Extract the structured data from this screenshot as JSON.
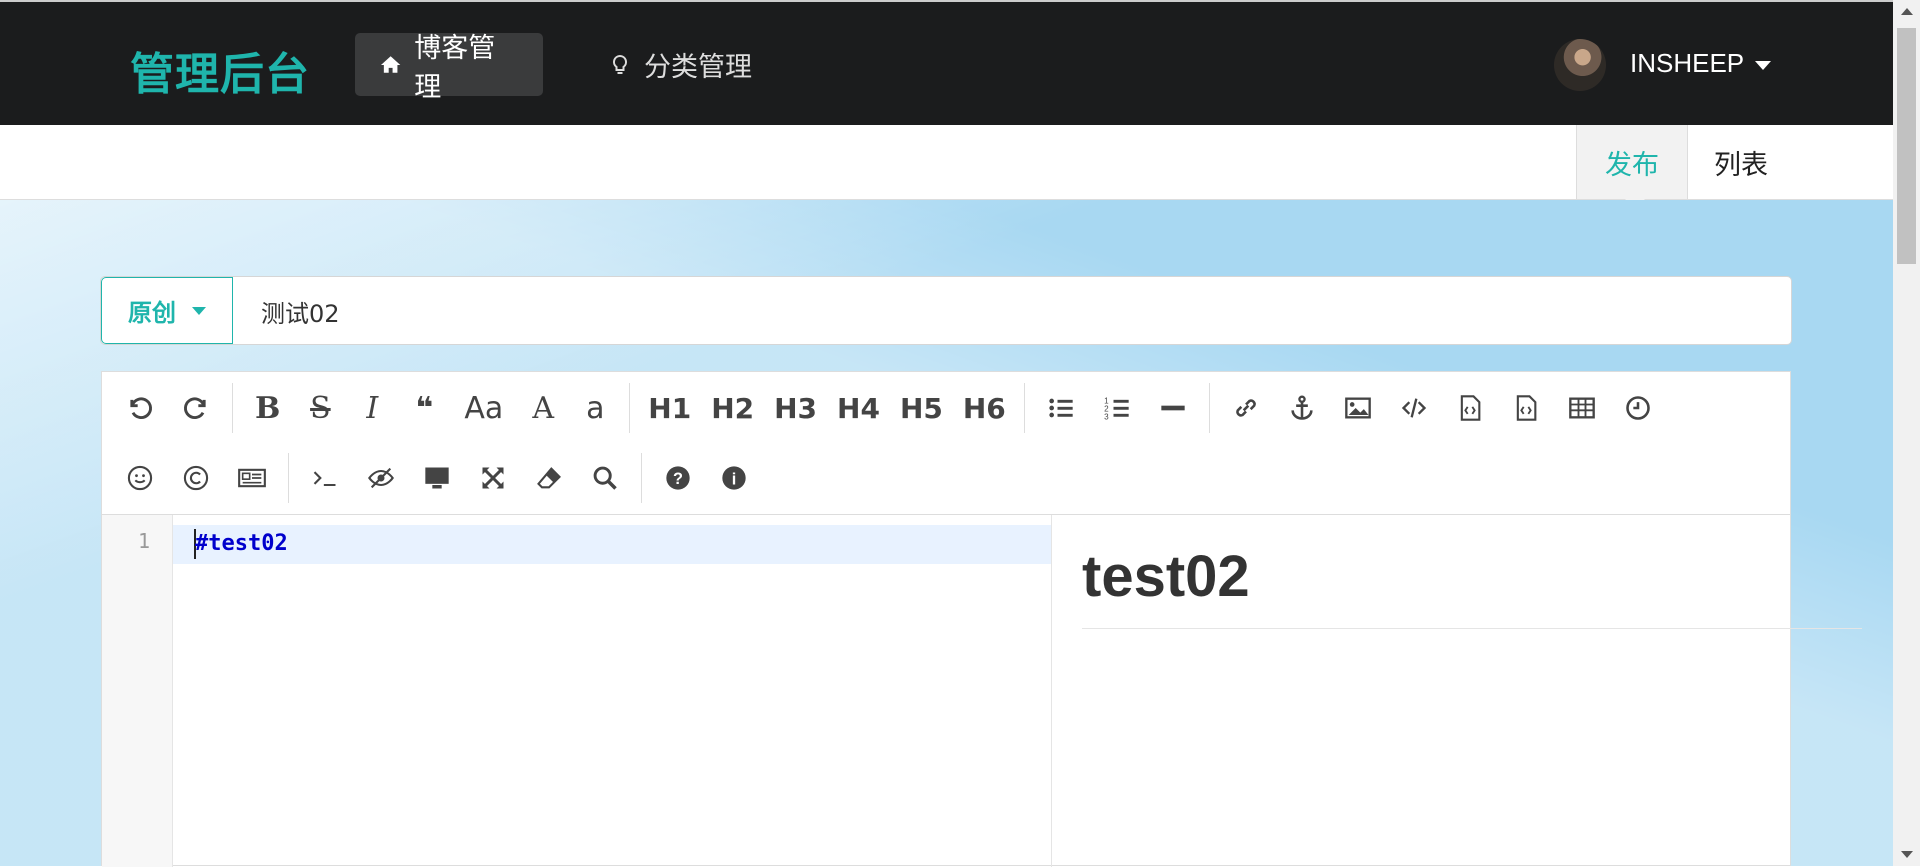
{
  "header": {
    "brand": "管理后台",
    "nav": [
      {
        "label": "博客管理",
        "icon": "home-icon",
        "active": true
      },
      {
        "label": "分类管理",
        "icon": "lightbulb-icon",
        "active": false
      }
    ],
    "username": "INSHEEP"
  },
  "tabs": [
    {
      "label": "发布",
      "active": true
    },
    {
      "label": "列表",
      "active": false
    }
  ],
  "form": {
    "type_label": "原创",
    "title_value": "测试02"
  },
  "toolbar": {
    "row1": [
      "undo-icon",
      "redo-icon",
      "|",
      "bold-icon",
      "strikethrough-icon",
      "italic-icon",
      "quote-icon",
      "uppercase-icon",
      "uppercase-first-icon",
      "lowercase-icon",
      "|",
      "H1",
      "H2",
      "H3",
      "H4",
      "H5",
      "H6",
      "|",
      "unordered-list-icon",
      "ordered-list-icon",
      "horizontal-rule-icon",
      "|",
      "link-icon",
      "anchor-icon",
      "image-icon",
      "code-icon",
      "code-block-icon",
      "preformatted-icon",
      "table-icon",
      "datetime-icon"
    ],
    "row2": [
      "emoji-icon",
      "html-entities-icon",
      "pagebreak-icon",
      "|",
      "terminal-icon",
      "watch-icon",
      "preview-icon",
      "fullscreen-icon",
      "clear-icon",
      "search-icon",
      "|",
      "help-icon",
      "info-icon"
    ],
    "labels": {
      "uppercase": "Aa",
      "uppercase_first": "A",
      "lowercase": "a",
      "H1": "H1",
      "H2": "H2",
      "H3": "H3",
      "H4": "H4",
      "H5": "H5",
      "H6": "H6"
    }
  },
  "editor": {
    "line_number": "1",
    "code": "#test02",
    "preview_heading": "test02"
  },
  "colors": {
    "accent": "#1fb5ac",
    "topbar": "#1b1c1d",
    "background": "#a8d8f2"
  }
}
